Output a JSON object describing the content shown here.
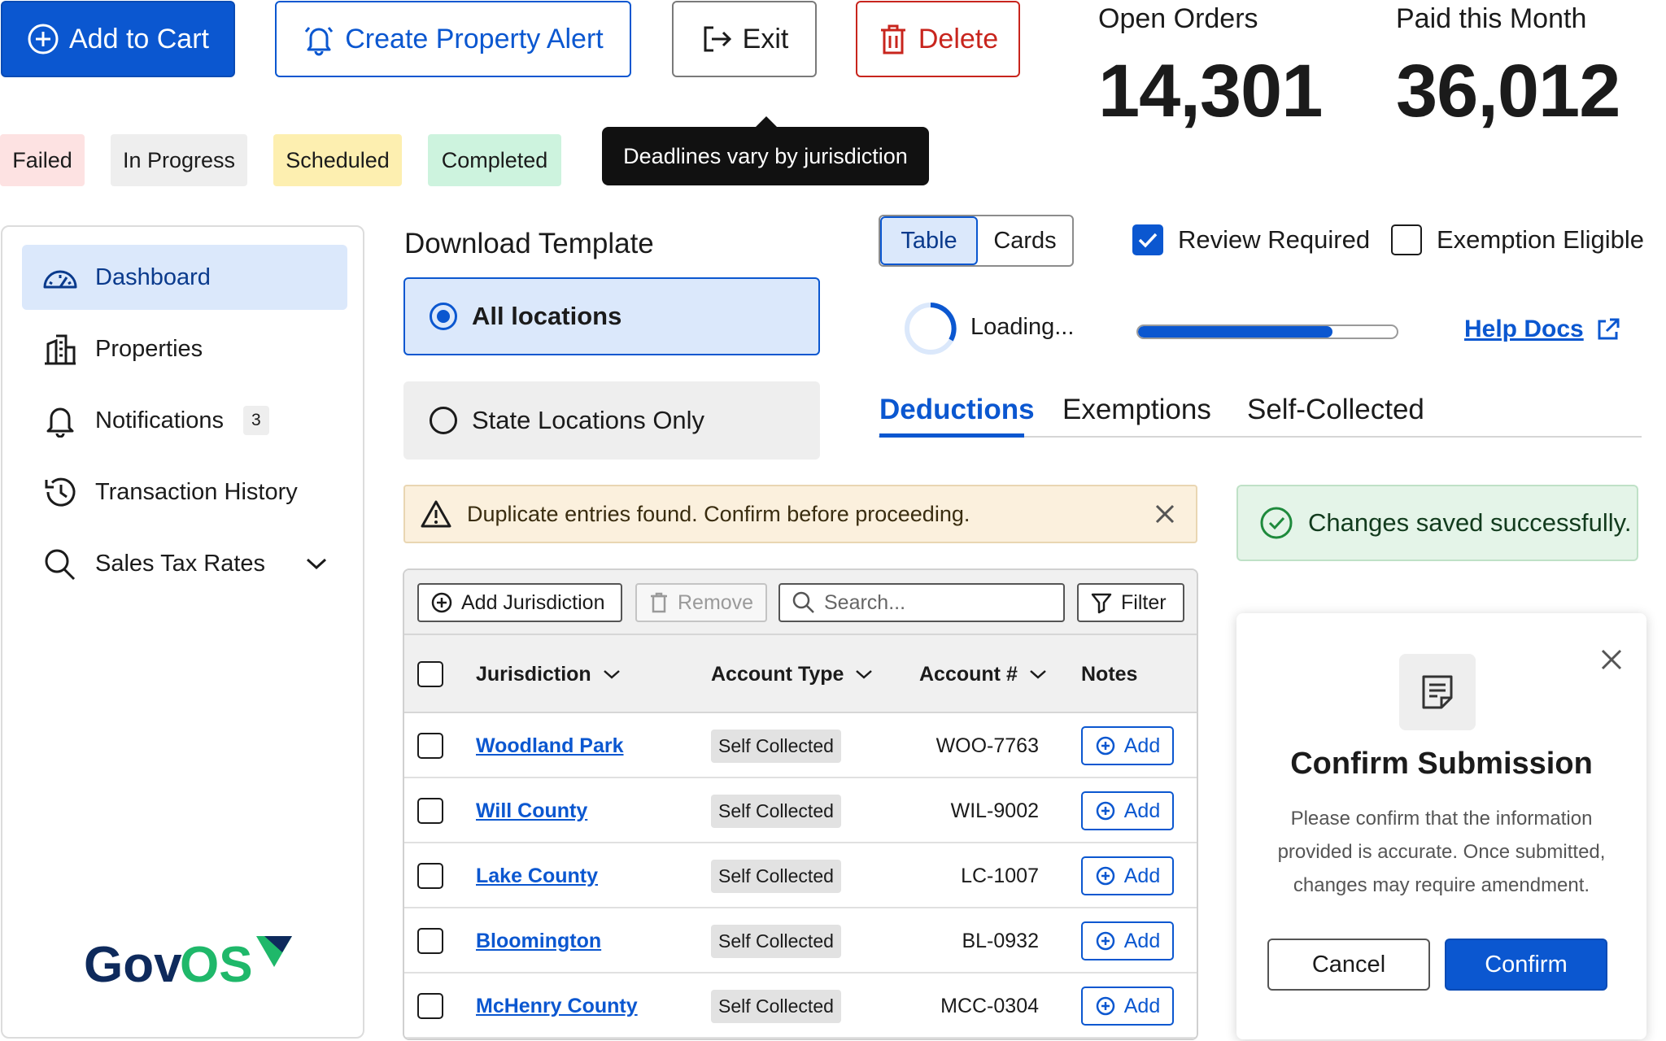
{
  "top_buttons": {
    "add_to_cart": "Add to Cart",
    "create_alert": "Create Property Alert",
    "exit": "Exit",
    "delete": "Delete"
  },
  "status_tags": [
    "Failed",
    "In Progress",
    "Scheduled",
    "Completed"
  ],
  "tooltip": "Deadlines vary by jurisdiction",
  "stats": {
    "open_orders_label": "Open Orders",
    "open_orders_value": "14,301",
    "paid_label": "Paid this Month",
    "paid_value": "36,012"
  },
  "sidebar": {
    "items": [
      {
        "label": "Dashboard",
        "icon": "gauge-icon",
        "active": true
      },
      {
        "label": "Properties",
        "icon": "building-icon"
      },
      {
        "label": "Notifications",
        "icon": "bell-icon",
        "badge": "3"
      },
      {
        "label": "Transaction History",
        "icon": "history-icon"
      },
      {
        "label": "Sales Tax Rates",
        "icon": "search-icon"
      }
    ],
    "logo": "GovOS"
  },
  "download": {
    "title": "Download Template",
    "options": [
      "All locations",
      "State Locations Only"
    ],
    "selected": "All locations"
  },
  "view_toggle": {
    "options": [
      "Table",
      "Cards"
    ],
    "selected": "Table"
  },
  "checkboxes": {
    "review_required": "Review Required",
    "exemption_eligible": "Exemption Eligible"
  },
  "loading": {
    "label": "Loading...",
    "progress": 0.75
  },
  "help_link": "Help Docs",
  "tabs": {
    "items": [
      "Deductions",
      "Exemptions",
      "Self-Collected"
    ],
    "selected": "Deductions"
  },
  "alerts": {
    "warning": "Duplicate entries found. Confirm before proceeding.",
    "success": "Changes saved successfully."
  },
  "toolbar": {
    "add": "Add Jurisdiction",
    "remove": "Remove",
    "search_placeholder": "Search...",
    "filter": "Filter"
  },
  "table": {
    "headers": [
      "Jurisdiction",
      "Account Type",
      "Account #",
      "Notes"
    ],
    "rows": [
      {
        "jurisdiction": "Woodland Park",
        "type": "Self Collected",
        "account": "WOO-7763",
        "notes": "Add"
      },
      {
        "jurisdiction": "Will County",
        "type": "Self Collected",
        "account": "WIL-9002",
        "notes": "Add"
      },
      {
        "jurisdiction": "Lake County",
        "type": "Self Collected",
        "account": "LC-1007",
        "notes": "Add"
      },
      {
        "jurisdiction": "Bloomington",
        "type": "Self Collected",
        "account": "BL-0932",
        "notes": "Add"
      },
      {
        "jurisdiction": "McHenry County",
        "type": "Self Collected",
        "account": "MCC-0304",
        "notes": "Add"
      }
    ]
  },
  "modal": {
    "title": "Confirm Submission",
    "body": "Please confirm that the information provided is accurate. Once submitted, changes may require amendment.",
    "cancel": "Cancel",
    "confirm": "Confirm"
  },
  "colors": {
    "primary": "#0b57d0",
    "danger": "#c8251d",
    "logo_navy": "#0e2a5c",
    "logo_green": "#1fb86a"
  }
}
